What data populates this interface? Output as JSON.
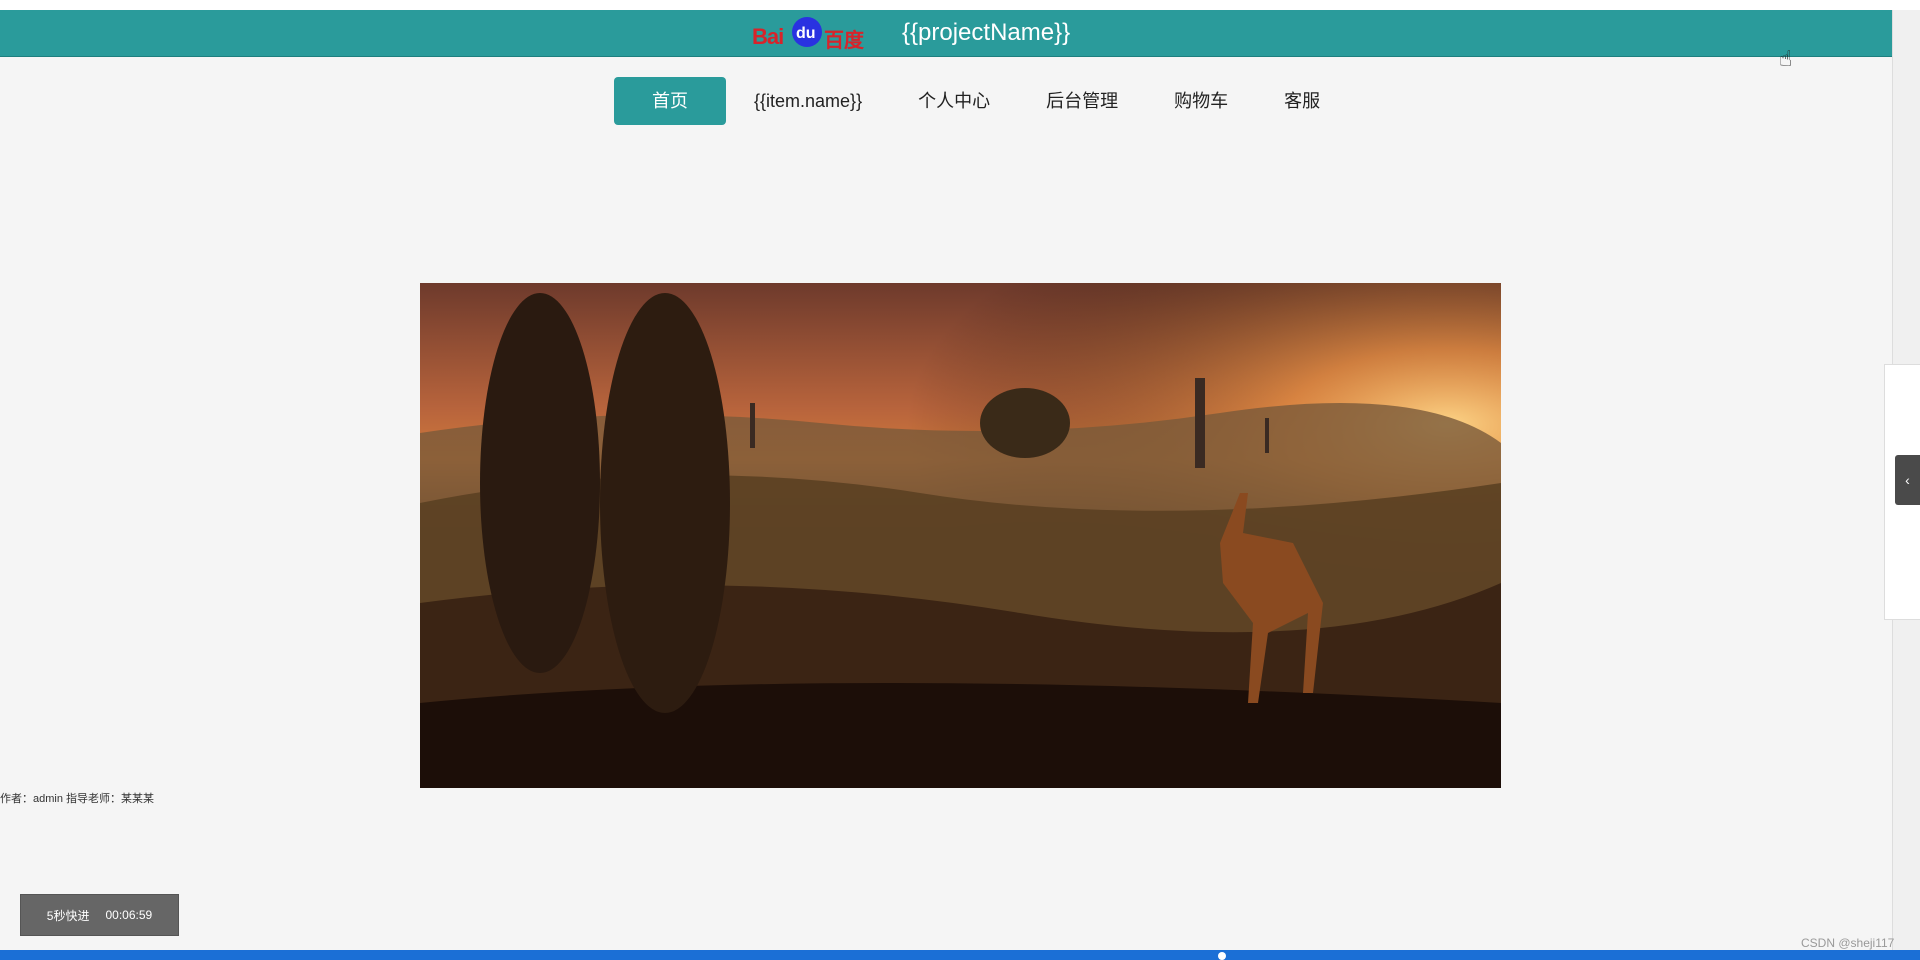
{
  "header": {
    "logo_text": "Bai",
    "logo_paw": "du",
    "logo_cn": "百度",
    "title": "{{projectName}}"
  },
  "nav": {
    "items": [
      {
        "label": "首页",
        "active": true
      },
      {
        "label": "{{item.name}}",
        "active": false
      },
      {
        "label": "个人中心",
        "active": false
      },
      {
        "label": "后台管理",
        "active": false
      },
      {
        "label": "购物车",
        "active": false
      },
      {
        "label": "客服",
        "active": false
      }
    ]
  },
  "banner": {
    "alt": "sunset-deer-landscape"
  },
  "footer": {
    "author": "作者：admin 指导老师：某某某"
  },
  "player": {
    "fast_forward_label": "5秒快进",
    "time": "00:06:59"
  },
  "side": {
    "toggle_icon": "‹"
  },
  "watermark": "CSDN @sheji117",
  "colors": {
    "header_bg": "#2a9b9b",
    "accent": "#2a9b9b",
    "page_bg": "#f5f5f5"
  }
}
